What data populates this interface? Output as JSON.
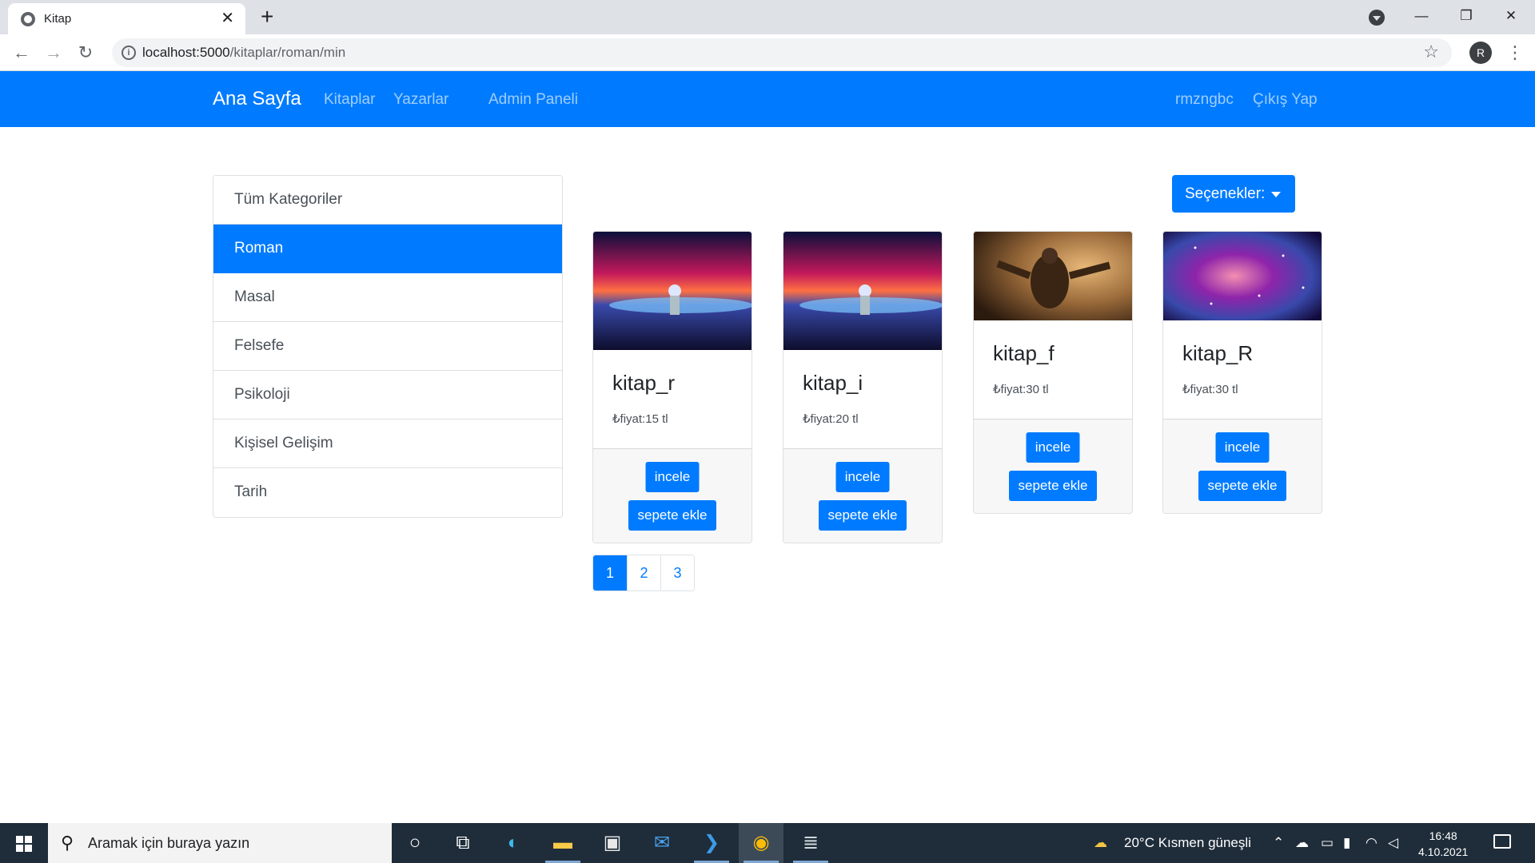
{
  "browser": {
    "tab_title": "Kitap",
    "url_host": "localhost:5000",
    "url_path": "/kitaplar/roman/min",
    "profile_initial": "R"
  },
  "navbar": {
    "brand": "Ana Sayfa",
    "links": [
      "Kitaplar",
      "Yazarlar",
      "Admin Paneli"
    ],
    "user": "rmzngbc",
    "logout": "Çıkış Yap"
  },
  "categories": [
    {
      "label": "Tüm Kategoriler",
      "active": false
    },
    {
      "label": "Roman",
      "active": true
    },
    {
      "label": "Masal",
      "active": false
    },
    {
      "label": "Felsefe",
      "active": false
    },
    {
      "label": "Psikoloji",
      "active": false
    },
    {
      "label": "Kişisel Gelişim",
      "active": false
    },
    {
      "label": "Tarih",
      "active": false
    }
  ],
  "options_button": "Seçenekler:",
  "books": [
    {
      "title": "kitap_r",
      "price": "₺fiyat:15 tl",
      "image": "astronaut-space-image",
      "view": "incele",
      "add": "sepete ekle"
    },
    {
      "title": "kitap_i",
      "price": "₺fiyat:20 tl",
      "image": "astronaut-space-image",
      "view": "incele",
      "add": "sepete ekle"
    },
    {
      "title": "kitap_f",
      "price": "₺fiyat:30 tl",
      "image": "man-in-rain-image",
      "view": "incele",
      "add": "sepete ekle"
    },
    {
      "title": "kitap_R",
      "price": "₺fiyat:30 tl",
      "image": "galaxy-nebula-image",
      "view": "incele",
      "add": "sepete ekle"
    }
  ],
  "pagination": {
    "pages": [
      "1",
      "2",
      "3"
    ],
    "current": "1"
  },
  "taskbar": {
    "search_placeholder": "Aramak için buraya yazın",
    "weather": "20°C  Kısmen güneşli",
    "time": "16:48",
    "date": "4.10.2021"
  },
  "colors": {
    "primary": "#007bff",
    "taskbar": "#1f2d3a"
  }
}
